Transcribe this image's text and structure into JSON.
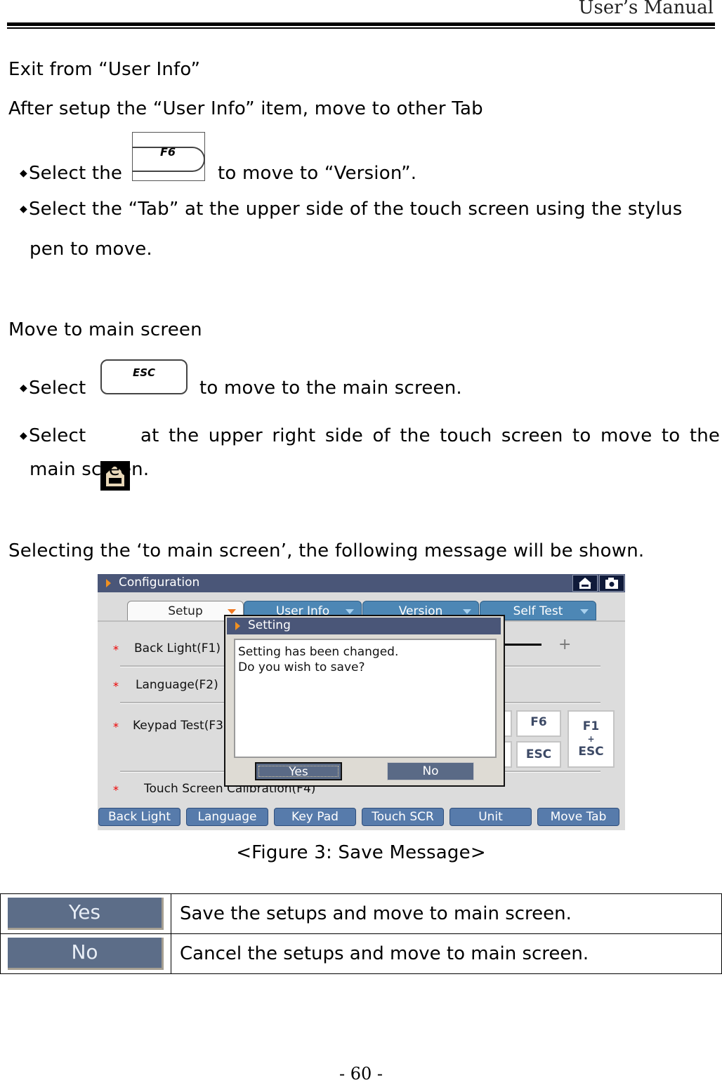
{
  "header": {
    "title": "User’s Manual"
  },
  "section_exit": {
    "heading": "Exit from “User Info”",
    "intro": "After setup the  “User Info” item, move to other Tab",
    "bullet1_pre": "Select the",
    "bullet1_key": "F6",
    "bullet1_post": "to move to “Version”.",
    "bullet2_line1": "Select the “Tab” at the upper side of the touch screen using the stylus",
    "bullet2_line2": "pen to move."
  },
  "section_main": {
    "heading": "Move to main screen",
    "bullet1_pre": "Select",
    "bullet1_key": "ESC",
    "bullet1_post": "to move to the main screen.",
    "bullet2_pre": "Select",
    "bullet2_icon": "home-icon",
    "bullet2_post": "at the upper right side of the touch screen to move to the",
    "bullet2_line2": "main screen."
  },
  "selecting_text": "Selecting the ‘to main screen’, the following message will be shown.",
  "figure": {
    "caption": "<Figure 3: Save Message>",
    "window_title": "Configuration",
    "title_icons": [
      "home-icon",
      "camera-icon"
    ],
    "tabs": [
      {
        "label": "Setup",
        "active": true
      },
      {
        "label": "User Info",
        "active": false
      },
      {
        "label": "Version",
        "active": false
      },
      {
        "label": "Self Test",
        "active": false
      }
    ],
    "rows": [
      {
        "label": "Back Light(F1)"
      },
      {
        "label": "Language(F2)"
      },
      {
        "label": "Keypad Test(F3"
      },
      {
        "label": "Touch Screen Calibration(F4)"
      }
    ],
    "keypad": {
      "f6": "F6",
      "esc": "ESC",
      "combo_top": "F1",
      "combo_plus": "+",
      "combo_bottom": "ESC"
    },
    "slider_plus": "+",
    "bottom_buttons": [
      "Back Light",
      "Language",
      "Key Pad",
      "Touch SCR",
      "Unit",
      "Move Tab"
    ],
    "dialog": {
      "title": "Setting",
      "line1": "Setting has been changed.",
      "line2": "Do you wish to save?",
      "yes": "Yes",
      "no": "No"
    }
  },
  "legend_table": [
    {
      "button": "Yes",
      "description": "Save the setups and move to main screen."
    },
    {
      "button": "No",
      "description": "Cancel the setups and move to main screen."
    }
  ],
  "footer": {
    "page_number": "- 60 -"
  }
}
